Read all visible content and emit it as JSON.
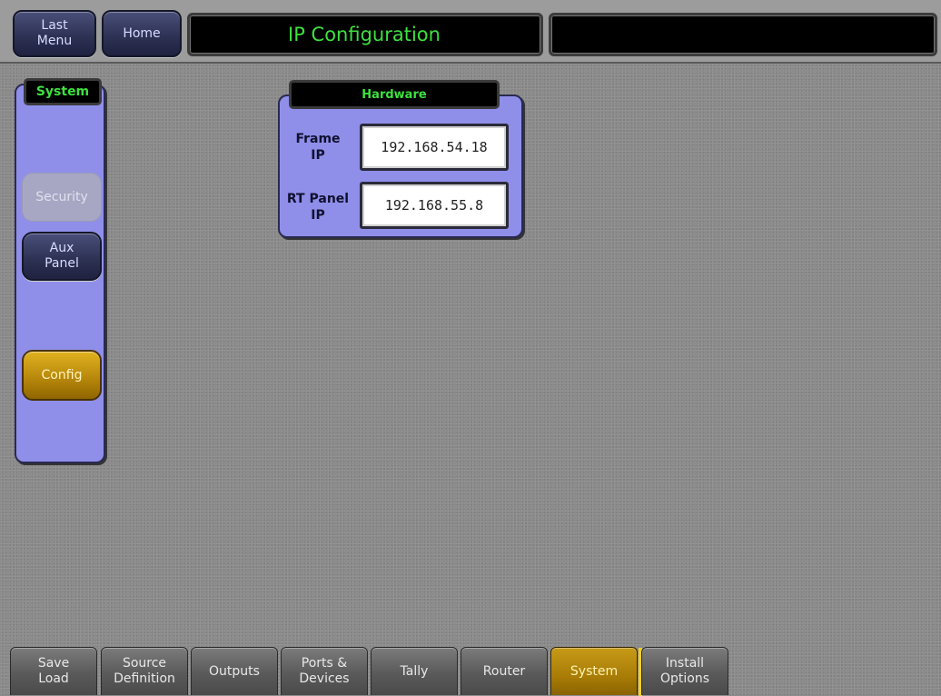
{
  "header": {
    "last_menu_label": "Last\nMenu",
    "home_label": "Home",
    "title": "IP Configuration",
    "secondary_title": ""
  },
  "sidebar": {
    "group_label": "System",
    "items": [
      {
        "label": "Security",
        "state": "disabled"
      },
      {
        "label": "Aux\nPanel",
        "state": "normal"
      },
      {
        "label": "Config",
        "state": "active"
      }
    ]
  },
  "hardware": {
    "group_label": "Hardware",
    "fields": [
      {
        "label": "Frame\nIP",
        "value": "192.168.54.18"
      },
      {
        "label": "RT Panel\nIP",
        "value": "192.168.55.8"
      }
    ]
  },
  "tabs": [
    {
      "label": "Save\nLoad"
    },
    {
      "label": "Source\nDefinition"
    },
    {
      "label": "Outputs"
    },
    {
      "label": "Ports &\nDevices"
    },
    {
      "label": "Tally"
    },
    {
      "label": "Router"
    },
    {
      "label": "System",
      "active": true
    },
    {
      "label": "Install\nOptions"
    }
  ],
  "colors": {
    "panel_blue": "#8f8fea",
    "title_green": "#3fe03f",
    "active_gold": "#b5850a"
  }
}
